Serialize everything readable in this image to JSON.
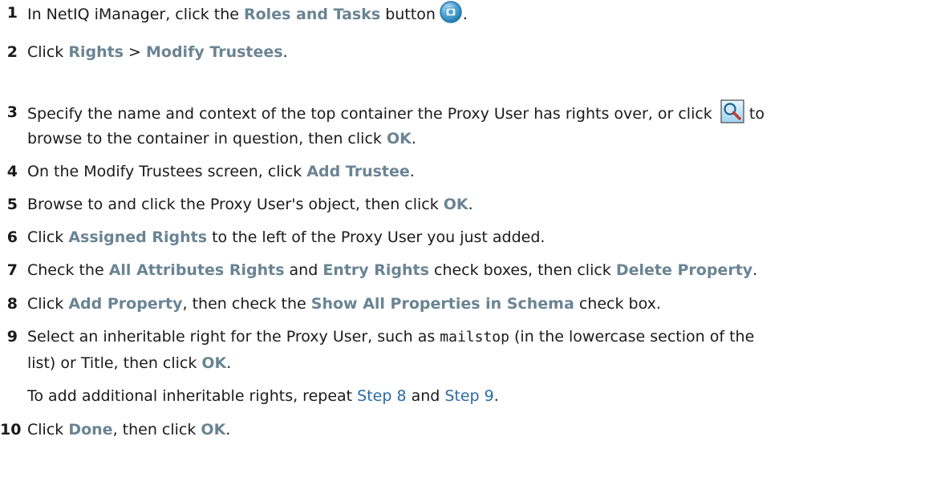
{
  "steps": [
    {
      "num": "1",
      "parts": [
        {
          "t": "text",
          "v": "In NetIQ iManager, click the "
        },
        {
          "t": "ui",
          "v": "Roles and Tasks"
        },
        {
          "t": "text",
          "v": " button"
        },
        {
          "t": "icon",
          "icon": "roles-and-tasks-icon"
        },
        {
          "t": "text",
          "v": "."
        }
      ]
    },
    {
      "num": "2",
      "parts": [
        {
          "t": "text",
          "v": "Click "
        },
        {
          "t": "ui",
          "v": "Rights"
        },
        {
          "t": "text",
          "v": " > "
        },
        {
          "t": "ui",
          "v": "Modify Trustees"
        },
        {
          "t": "text",
          "v": "."
        }
      ]
    },
    {
      "num": "3",
      "lines": [
        [
          {
            "t": "text",
            "v": "Specify the name and context of the top container the Proxy User has rights over, or click "
          },
          {
            "t": "icon",
            "icon": "browse-search-icon"
          },
          {
            "t": "text",
            "v": " to"
          }
        ],
        [
          {
            "t": "text",
            "v": "browse to the container in question, then click "
          },
          {
            "t": "ui",
            "v": "OK"
          },
          {
            "t": "text",
            "v": "."
          }
        ]
      ]
    },
    {
      "num": "4",
      "parts": [
        {
          "t": "text",
          "v": "On the Modify Trustees screen, click "
        },
        {
          "t": "ui",
          "v": "Add Trustee"
        },
        {
          "t": "text",
          "v": "."
        }
      ]
    },
    {
      "num": "5",
      "parts": [
        {
          "t": "text",
          "v": "Browse to and click the Proxy User's object, then click "
        },
        {
          "t": "ui",
          "v": "OK"
        },
        {
          "t": "text",
          "v": "."
        }
      ]
    },
    {
      "num": "6",
      "parts": [
        {
          "t": "text",
          "v": "Click "
        },
        {
          "t": "ui",
          "v": "Assigned Rights"
        },
        {
          "t": "text",
          "v": " to the left of the Proxy User you just added."
        }
      ]
    },
    {
      "num": "7",
      "parts": [
        {
          "t": "text",
          "v": "Check the "
        },
        {
          "t": "ui",
          "v": "All Attributes Rights"
        },
        {
          "t": "text",
          "v": " and "
        },
        {
          "t": "ui",
          "v": "Entry Rights"
        },
        {
          "t": "text",
          "v": " check boxes, then click "
        },
        {
          "t": "ui",
          "v": "Delete Property"
        },
        {
          "t": "text",
          "v": "."
        }
      ]
    },
    {
      "num": "8",
      "parts": [
        {
          "t": "text",
          "v": "Click "
        },
        {
          "t": "ui",
          "v": "Add Property"
        },
        {
          "t": "text",
          "v": ", then check the "
        },
        {
          "t": "ui",
          "v": "Show All Properties in Schema"
        },
        {
          "t": "text",
          "v": " check box."
        }
      ]
    },
    {
      "num": "9",
      "lines": [
        [
          {
            "t": "text",
            "v": "Select an inheritable right for the Proxy User, such as "
          },
          {
            "t": "mono",
            "v": "mailstop"
          },
          {
            "t": "text",
            "v": " (in the lowercase section of the"
          }
        ],
        [
          {
            "t": "text",
            "v": "list) or Title, then click "
          },
          {
            "t": "ui",
            "v": "OK"
          },
          {
            "t": "text",
            "v": "."
          }
        ]
      ]
    },
    {
      "num": "",
      "parts": [
        {
          "t": "text",
          "v": "To add additional inheritable rights, repeat "
        },
        {
          "t": "link",
          "v": "Step 8"
        },
        {
          "t": "text",
          "v": " and "
        },
        {
          "t": "link",
          "v": "Step 9"
        },
        {
          "t": "text",
          "v": "."
        }
      ]
    },
    {
      "num": "10",
      "parts": [
        {
          "t": "text",
          "v": "Click "
        },
        {
          "t": "ui",
          "v": "Done"
        },
        {
          "t": "text",
          "v": ", then click "
        },
        {
          "t": "ui",
          "v": "OK"
        },
        {
          "t": "text",
          "v": "."
        }
      ]
    }
  ]
}
